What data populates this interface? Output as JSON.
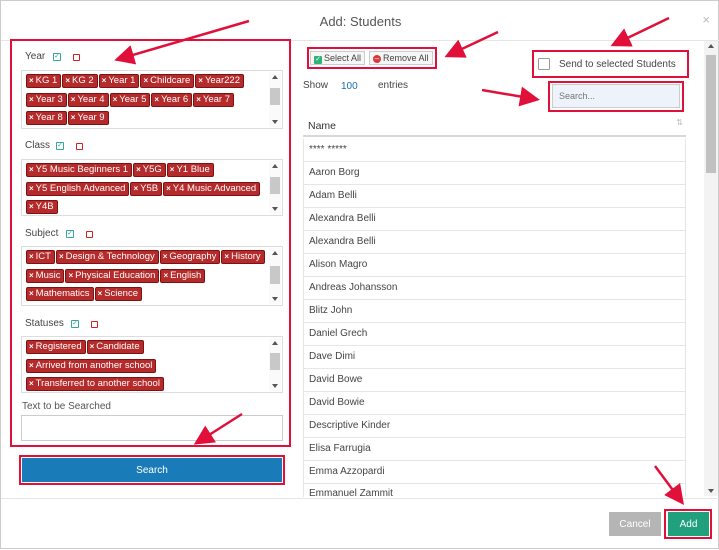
{
  "modal": {
    "title": "Add: Students",
    "close_label": "×"
  },
  "filters": {
    "year": {
      "label": "Year",
      "tags": [
        "KG 1",
        "KG 2",
        "Year 1",
        "Childcare",
        "Year222",
        "Year 3",
        "Year 4",
        "Year 5",
        "Year 6",
        "Year 7",
        "Year 8",
        "Year 9"
      ]
    },
    "class": {
      "label": "Class",
      "tags": [
        "Y5 Music Beginners 1",
        "Y5G",
        "Y1 Blue",
        "Y5 English Advanced",
        "Y5B",
        "Y4 Music Advanced",
        "Y4B"
      ]
    },
    "subject": {
      "label": "Subject",
      "tags": [
        "ICT",
        "Design & Technology",
        "Geography",
        "History",
        "Music",
        "Physical Education",
        "English",
        "Mathematics",
        "Science"
      ]
    },
    "statuses": {
      "label": "Statuses",
      "tags": [
        "Registered",
        "Candidate",
        "Arrived from another school",
        "Transferred to another school"
      ]
    },
    "text_search": {
      "label": "Text to be Searched",
      "value": ""
    },
    "search_button": "Search"
  },
  "toolbar": {
    "select_all": "Select All",
    "remove_all": "Remove All",
    "send_selected": "Send to selected Students"
  },
  "table": {
    "show_label": "Show",
    "entries_value": "100",
    "entries_label": "entries",
    "search_placeholder": "Search...",
    "column_name": "Name",
    "rows": [
      "**** *****",
      "Aaron Borg",
      "Adam Belli",
      "Alexandra Belli",
      "Alexandra Belli",
      "Alison Magro",
      "Andreas Johansson",
      "Blitz John",
      "Daniel Grech",
      "Dave Dimi",
      "David Bowe",
      "David Bowie",
      "Descriptive Kinder",
      "Elisa Farrugia",
      "Emma Azzopardi",
      "Emmanuel Zammit"
    ]
  },
  "footer": {
    "cancel": "Cancel",
    "add": "Add"
  },
  "colors": {
    "tag": "#b52a2a",
    "search_button": "#1a7bb9",
    "add_button": "#20a07c",
    "cancel_button": "#b5b5b5",
    "highlight": "#e0103a"
  }
}
